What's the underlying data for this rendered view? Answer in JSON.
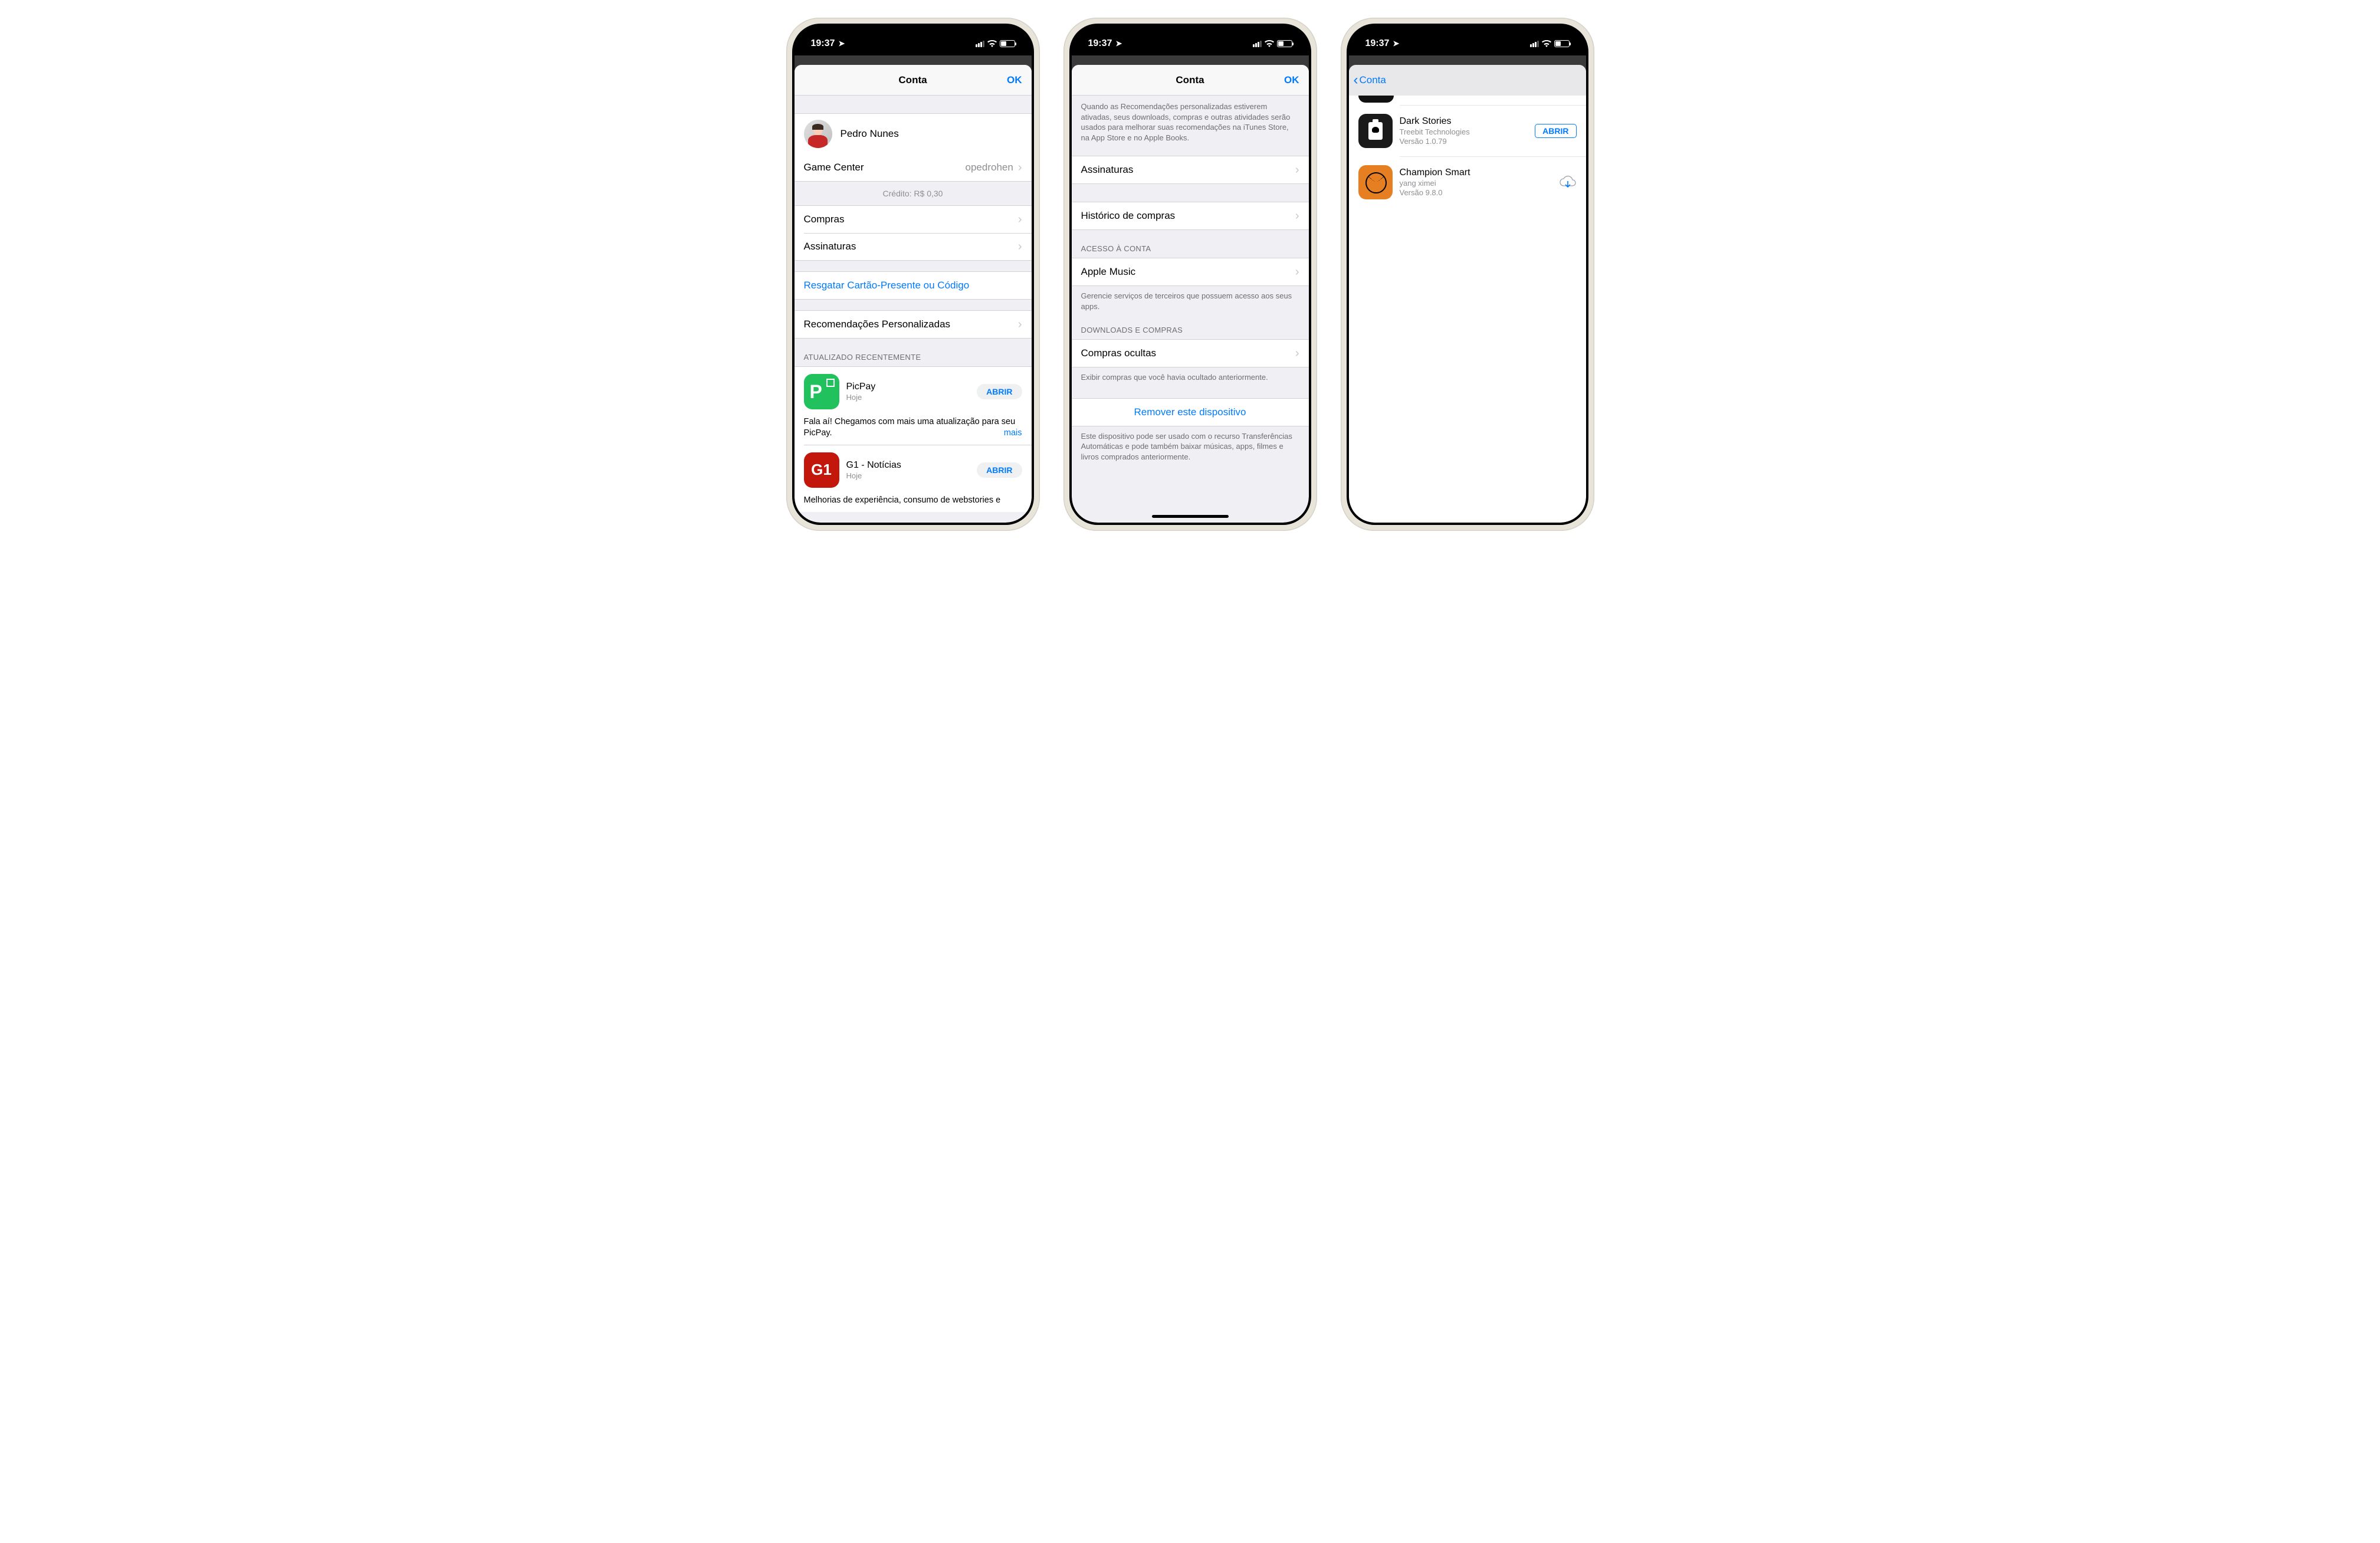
{
  "status": {
    "time": "19:37"
  },
  "phone1": {
    "title": "Conta",
    "done": "OK",
    "profile_name": "Pedro Nunes",
    "gamecenter_label": "Game Center",
    "gamecenter_value": "opedrohen",
    "credit": "Crédito: R$ 0,30",
    "purchases_label": "Compras",
    "subscriptions_label": "Assinaturas",
    "redeem_label": "Resgatar Cartão-Presente ou Código",
    "personalized_label": "Recomendações Personalizadas",
    "updated_header": "ATUALIZADO RECENTEMENTE",
    "apps": [
      {
        "name": "PicPay",
        "sub": "Hoje",
        "open": "ABRIR",
        "desc": "Fala aí! Chegamos com mais uma atualização para seu PicPay.",
        "more": "mais"
      },
      {
        "name": "G1 - Notícias",
        "sub": "Hoje",
        "open": "ABRIR",
        "desc": "Melhorias de experiência, consumo de webstories e "
      }
    ]
  },
  "phone2": {
    "title": "Conta",
    "done": "OK",
    "rec_footer": "Quando as Recomendações personalizadas estiverem ativadas, seus downloads, compras e outras atividades serão usados para melhorar suas recomendações na iTunes Store, na App Store e no Apple Books.",
    "subscriptions_label": "Assinaturas",
    "purchase_history_label": "Histórico de compras",
    "access_header": "ACESSO À CONTA",
    "apple_music_label": "Apple Music",
    "access_footer": "Gerencie serviços de terceiros que possuem acesso aos seus apps.",
    "downloads_header": "DOWNLOADS E COMPRAS",
    "hidden_label": "Compras ocultas",
    "hidden_footer": "Exibir compras que você havia ocultado anteriormente.",
    "remove_label": "Remover este dispositivo",
    "remove_footer": "Este dispositivo pode ser usado com o recurso Transferências Automáticas e pode também baixar músicas, apps, filmes e livros comprados anteriormente."
  },
  "phone3": {
    "back": "Conta",
    "apps": [
      {
        "name": "Dark Stories",
        "dev": "Treebit Technologies",
        "ver": "Versão 1.0.79",
        "open": "ABRIR"
      },
      {
        "name": "Champion Smart",
        "dev": "yang ximei",
        "ver": "Versão 9.8.0"
      }
    ]
  }
}
